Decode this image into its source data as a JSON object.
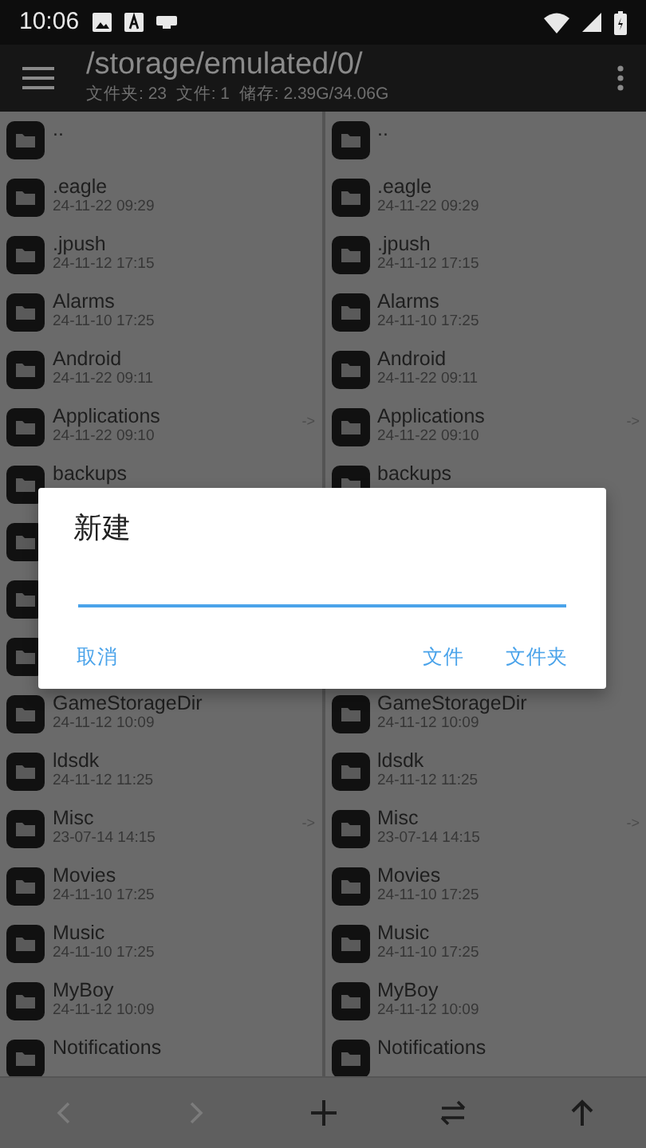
{
  "status_bar": {
    "time": "10:06"
  },
  "app_bar": {
    "title": "/storage/emulated/0/",
    "subtitle": "文件夹: 23  文件: 1  储存: 2.39G/34.06G"
  },
  "panes": [
    {
      "rows": [
        {
          "kind": "folder",
          "name": ".."
        },
        {
          "kind": "folder",
          "name": ".eagle",
          "date": "24-11-22 09:29"
        },
        {
          "kind": "folder",
          "name": ".jpush",
          "date": "24-11-12 17:15"
        },
        {
          "kind": "folder",
          "name": "Alarms",
          "date": "24-11-10 17:25"
        },
        {
          "kind": "folder",
          "name": "Android",
          "date": "24-11-22 09:11"
        },
        {
          "kind": "folder",
          "name": "Applications",
          "date": "24-11-22 09:10",
          "mark": "->"
        },
        {
          "kind": "folder",
          "name": "backups"
        },
        {
          "kind": "folder"
        },
        {
          "kind": "folder"
        },
        {
          "kind": "folder"
        },
        {
          "kind": "folder",
          "name": "GameStorageDir",
          "date": "24-11-12 10:09"
        },
        {
          "kind": "folder",
          "name": "ldsdk",
          "date": "24-11-12 11:25"
        },
        {
          "kind": "folder",
          "name": "Misc",
          "date": "23-07-14 14:15",
          "mark": "->"
        },
        {
          "kind": "folder",
          "name": "Movies",
          "date": "24-11-10 17:25"
        },
        {
          "kind": "folder",
          "name": "Music",
          "date": "24-11-10 17:25"
        },
        {
          "kind": "folder",
          "name": "MyBoy",
          "date": "24-11-12 10:09"
        },
        {
          "kind": "folder",
          "name": "Notifications"
        }
      ]
    },
    {
      "rows": [
        {
          "kind": "folder",
          "name": ".."
        },
        {
          "kind": "folder",
          "name": ".eagle",
          "date": "24-11-22 09:29"
        },
        {
          "kind": "folder",
          "name": ".jpush",
          "date": "24-11-12 17:15"
        },
        {
          "kind": "folder",
          "name": "Alarms",
          "date": "24-11-10 17:25"
        },
        {
          "kind": "folder",
          "name": "Android",
          "date": "24-11-22 09:11"
        },
        {
          "kind": "folder",
          "name": "Applications",
          "date": "24-11-22 09:10",
          "mark": "->"
        },
        {
          "kind": "folder",
          "name": "backups"
        },
        {
          "kind": "covered"
        },
        {
          "kind": "covered"
        },
        {
          "kind": "covered"
        },
        {
          "kind": "folder",
          "name": "GameStorageDir",
          "date": "24-11-12 10:09"
        },
        {
          "kind": "folder",
          "name": "ldsdk",
          "date": "24-11-12 11:25"
        },
        {
          "kind": "folder",
          "name": "Misc",
          "date": "23-07-14 14:15",
          "mark": "->"
        },
        {
          "kind": "folder",
          "name": "Movies",
          "date": "24-11-10 17:25"
        },
        {
          "kind": "folder",
          "name": "Music",
          "date": "24-11-10 17:25"
        },
        {
          "kind": "folder",
          "name": "MyBoy",
          "date": "24-11-12 10:09"
        },
        {
          "kind": "folder",
          "name": "Notifications"
        }
      ]
    }
  ],
  "dialog": {
    "title": "新建",
    "actions": [
      {
        "label": "取消",
        "kind": "left"
      },
      {
        "label": "文件",
        "kind": "right"
      },
      {
        "label": "文件夹",
        "kind": "right"
      }
    ]
  },
  "bottom_bar": [
    {
      "kind": "back",
      "disabled": true
    },
    {
      "kind": "forward",
      "disabled": true
    },
    {
      "kind": "add",
      "disabled": false
    },
    {
      "kind": "swap",
      "disabled": false
    },
    {
      "kind": "up",
      "disabled": false
    }
  ]
}
